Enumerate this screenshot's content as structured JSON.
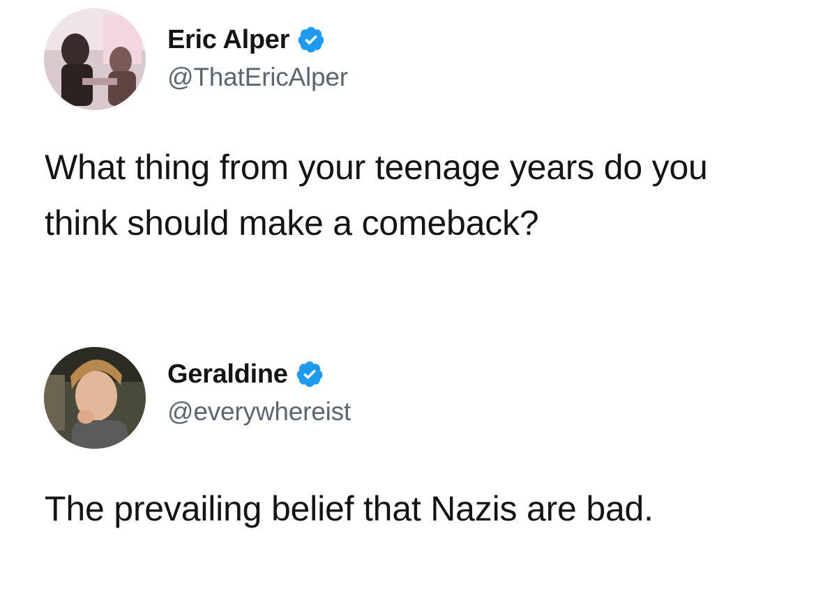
{
  "tweets": [
    {
      "display_name": "Eric Alper",
      "handle": "@ThatEricAlper",
      "verified": true,
      "avatar_icon": "user-avatar-photo",
      "text": "What thing from your teenage years do you think should make a comeback?"
    },
    {
      "display_name": "Geraldine",
      "handle": "@everywhereist",
      "verified": true,
      "avatar_icon": "user-avatar-photo",
      "text": "The prevailing belief that Nazis are bad."
    }
  ],
  "colors": {
    "verified_badge": "#1d9bf0",
    "handle": "#5b6670",
    "text": "#141414",
    "background": "#ffffff"
  }
}
